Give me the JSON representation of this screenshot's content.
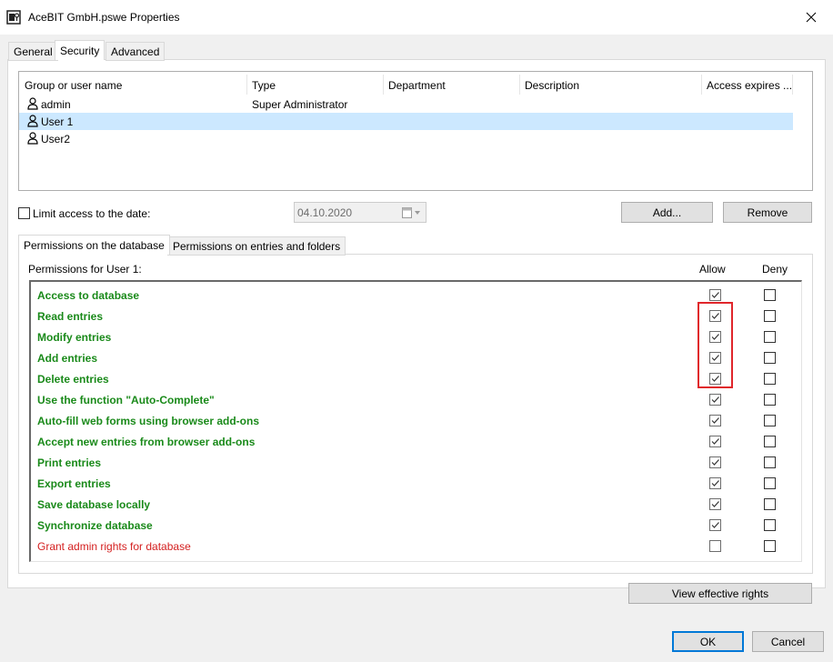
{
  "window": {
    "title": "AceBIT GmbH.pswe Properties",
    "app_icon": "database-key-icon",
    "close_icon": "close-icon"
  },
  "tabs": [
    {
      "label": "General",
      "active": false
    },
    {
      "label": "Security",
      "active": true
    },
    {
      "label": "Advanced",
      "active": false
    }
  ],
  "users_table": {
    "columns": [
      "Group or user name",
      "Type",
      "Department",
      "Description",
      "Access expires ..."
    ],
    "rows": [
      {
        "name": "admin",
        "type": "Super Administrator",
        "selected": false
      },
      {
        "name": "User 1",
        "type": "",
        "selected": true
      },
      {
        "name": "User2",
        "type": "",
        "selected": false
      }
    ]
  },
  "limit_access": {
    "label": "Limit access to the date:",
    "checked": false,
    "date_value": "04.10.2020"
  },
  "buttons": {
    "add": "Add...",
    "remove": "Remove",
    "view_effective_rights": "View effective rights",
    "ok": "OK",
    "cancel": "Cancel"
  },
  "permission_tabs": [
    {
      "label": "Permissions on the database",
      "active": true
    },
    {
      "label": "Permissions on entries and folders",
      "active": false
    }
  ],
  "permissions": {
    "header": "Permissions for User 1:",
    "allow_label": "Allow",
    "deny_label": "Deny",
    "items": [
      {
        "label": "Access to database",
        "allow": true,
        "deny": false,
        "danger": false
      },
      {
        "label": "Read entries",
        "allow": true,
        "deny": false,
        "danger": false
      },
      {
        "label": "Modify entries",
        "allow": true,
        "deny": false,
        "danger": false
      },
      {
        "label": "Add entries",
        "allow": true,
        "deny": false,
        "danger": false
      },
      {
        "label": "Delete entries",
        "allow": true,
        "deny": false,
        "danger": false
      },
      {
        "label": "Use the function \"Auto-Complete\"",
        "allow": true,
        "deny": false,
        "danger": false
      },
      {
        "label": "Auto-fill web forms using browser add-ons",
        "allow": true,
        "deny": false,
        "danger": false
      },
      {
        "label": "Accept new entries from browser add-ons",
        "allow": true,
        "deny": false,
        "danger": false
      },
      {
        "label": "Print entries",
        "allow": true,
        "deny": false,
        "danger": false
      },
      {
        "label": "Export entries",
        "allow": true,
        "deny": false,
        "danger": false
      },
      {
        "label": "Save database locally",
        "allow": true,
        "deny": false,
        "danger": false
      },
      {
        "label": "Synchronize database",
        "allow": true,
        "deny": false,
        "danger": false
      },
      {
        "label": "Grant admin rights for database",
        "allow": false,
        "deny": false,
        "danger": true
      }
    ]
  },
  "colors": {
    "permission_text": "#1a8a1a",
    "admin_permission_text": "#d42020",
    "selected_row": "#cce8ff",
    "highlight_box": "#e0262b",
    "default_button_border": "#0078d7"
  }
}
